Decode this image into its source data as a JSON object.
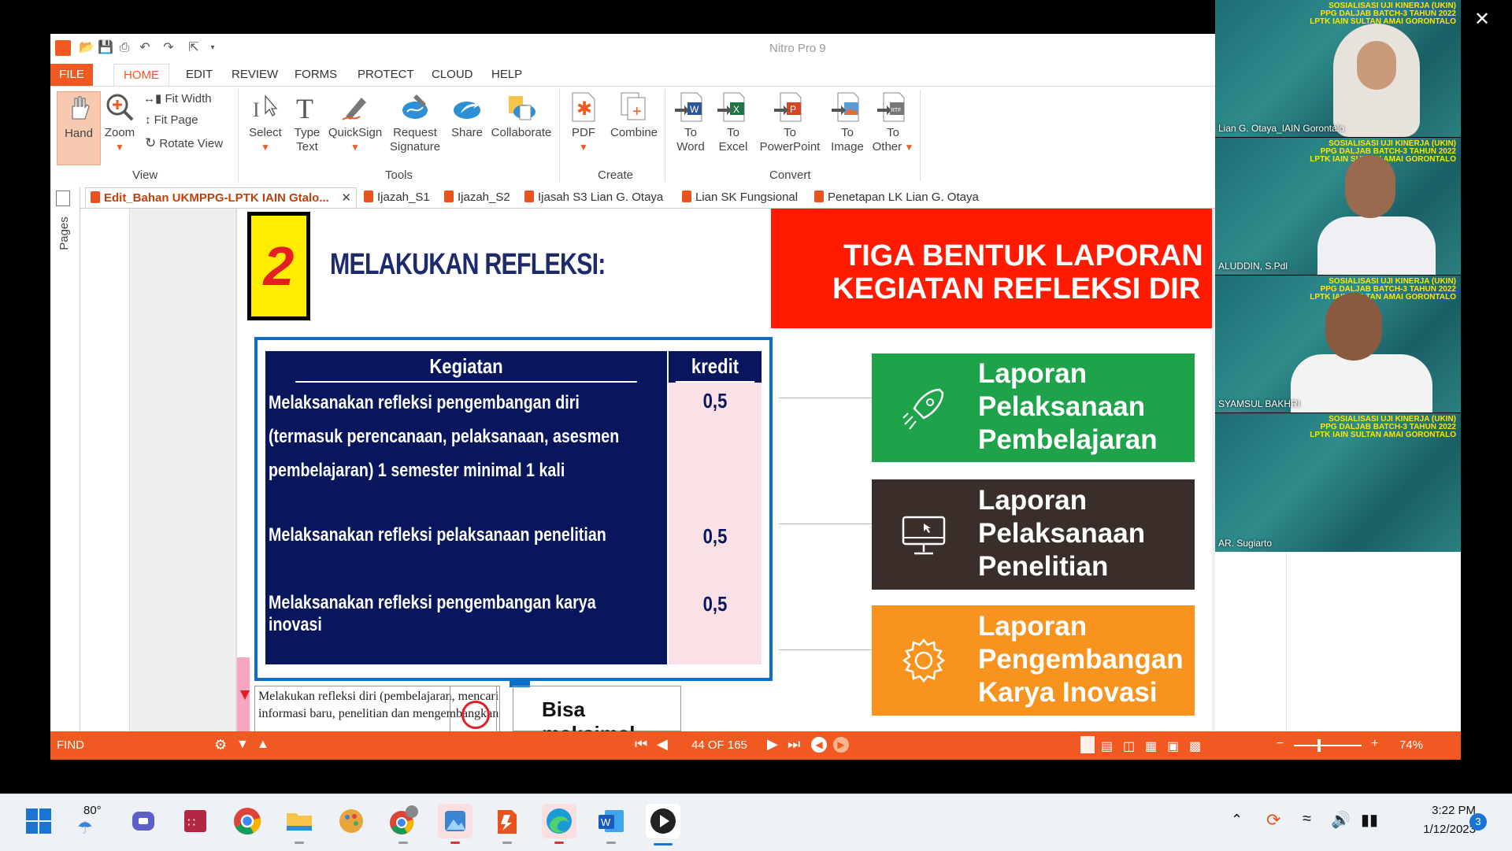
{
  "app": {
    "title": "Nitro Pro 9",
    "menu": [
      "FILE",
      "HOME",
      "EDIT",
      "REVIEW",
      "FORMS",
      "PROTECT",
      "CLOUD",
      "HELP"
    ]
  },
  "ribbon": {
    "view": {
      "hand": "Hand",
      "zoom": "Zoom",
      "fit_width": "Fit Width",
      "fit_page": "Fit Page",
      "rotate_view": "Rotate View",
      "group": "View"
    },
    "tools": {
      "select": "Select",
      "type_text": [
        "Type",
        "Text"
      ],
      "quicksign": "QuickSign",
      "request_signature": [
        "Request",
        "Signature"
      ],
      "share": "Share",
      "collaborate": "Collaborate",
      "group": "Tools"
    },
    "create": {
      "pdf": "PDF",
      "combine": "Combine",
      "group": "Create"
    },
    "convert": {
      "to_word": [
        "To",
        "Word"
      ],
      "to_excel": [
        "To",
        "Excel"
      ],
      "to_powerpoint": [
        "To",
        "PowerPoint"
      ],
      "to_image": [
        "To",
        "Image"
      ],
      "to_other": [
        "To",
        "Other"
      ],
      "group": "Convert"
    }
  },
  "pages_label": "Pages",
  "doc_tabs": [
    "Edit_Bahan UKMPPG-LPTK IAIN Gtalo...",
    "Ijazah_S1",
    "Ijazah_S2",
    "Ijasah S3 Lian G. Otaya",
    "Lian SK Fungsional",
    "Penetapan LK Lian G. Otaya"
  ],
  "slide": {
    "number": "2",
    "heading": "MELAKUKAN REFLEKSI:",
    "banner": [
      "TIGA BENTUK LAPORAN",
      "KEGIATAN REFLEKSI DIR"
    ],
    "table": {
      "headers": [
        "Kegiatan",
        "kredit"
      ],
      "rows": [
        {
          "kegiatan": "Melaksanakan refleksi pengembangan diri (termasuk perencanaan, pelaksanaan, asesmen pembelajaran) 1 semester minimal 1 kali",
          "kredit": "0,5"
        },
        {
          "kegiatan": "Melaksanakan refleksi pelaksanaan penelitian",
          "kredit": "0,5"
        },
        {
          "kegiatan": "Melaksanakan refleksi pengembangan karya inovasi",
          "kredit": "0,5"
        }
      ]
    },
    "cards": [
      {
        "lines": [
          "Laporan",
          "Pelaksanaan",
          "Pembelajaran"
        ],
        "color": "#1ea24a",
        "icon": "rocket-icon"
      },
      {
        "lines": [
          "Laporan",
          "Pelaksanaan",
          "Penelitian"
        ],
        "color": "#3a2e2a",
        "icon": "monitor-icon"
      },
      {
        "lines": [
          "Laporan",
          "Pengembangan",
          "Karya Inovasi"
        ],
        "color": "#f7931e",
        "icon": "gear-icon"
      }
    ],
    "bottom_left": [
      "Melakukan refleksi diri (pembelajaran, mencari",
      "informasi baru, penelitian dan mengembangkan karya"
    ],
    "bottom_right": "Bisa maksimal"
  },
  "status": {
    "find": "FIND",
    "page_indicator": "44 OF 165",
    "zoom": "74%"
  },
  "video": {
    "banner": [
      "SOSIALISASI UJI KINERJA (UKIN)",
      "PPG DALJAB BATCH-3 TAHUN 2022",
      "LPTK IAIN SULTAN AMAI GORONTALO"
    ],
    "participants": [
      "Lian G. Otaya_IAIN Gorontalo",
      "ALUDDIN, S.Pdl",
      "SYAMSUL BAKHRI",
      "AR. Sugiarto"
    ]
  },
  "taskbar": {
    "weather": "80°",
    "time": "3:22 PM",
    "date": "1/12/2023",
    "notifications": "3"
  }
}
